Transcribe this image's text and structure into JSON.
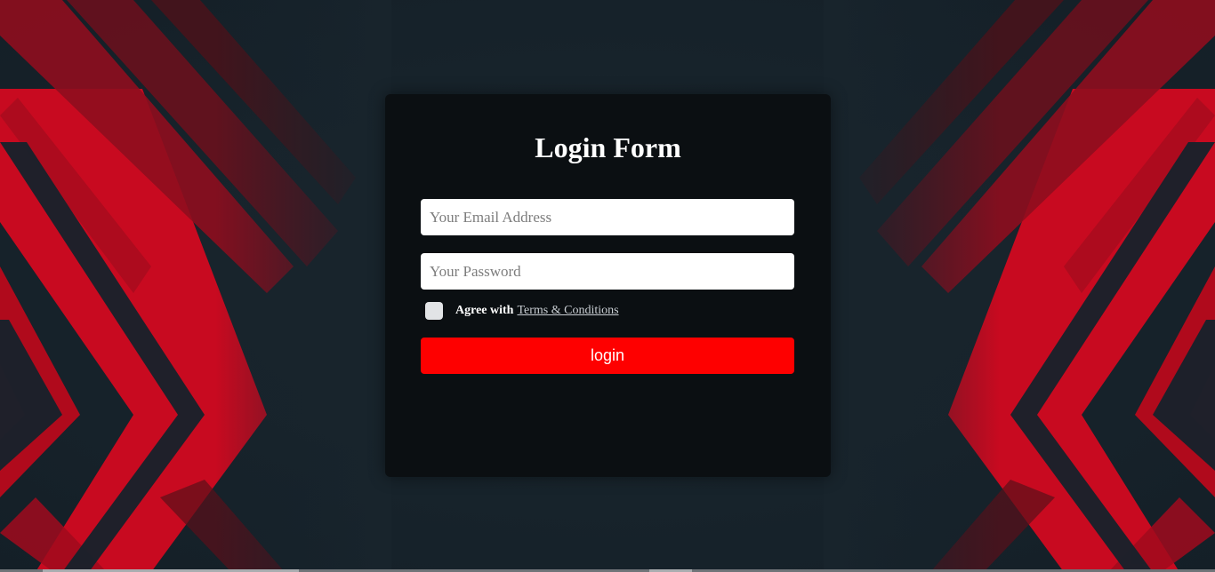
{
  "form": {
    "title": "Login Form",
    "email_placeholder": "Your Email Address",
    "password_placeholder": "Your Password",
    "agree_text": "Agree with",
    "terms_link": "Terms & Conditions",
    "login_label": "login"
  },
  "colors": {
    "page_background": "#16222b",
    "card_background": "#0b0f12",
    "accent_red": "#fe0000",
    "stripe_red": "#d10a22"
  },
  "icons": {
    "background": "red-chevron-stripes-pattern"
  }
}
